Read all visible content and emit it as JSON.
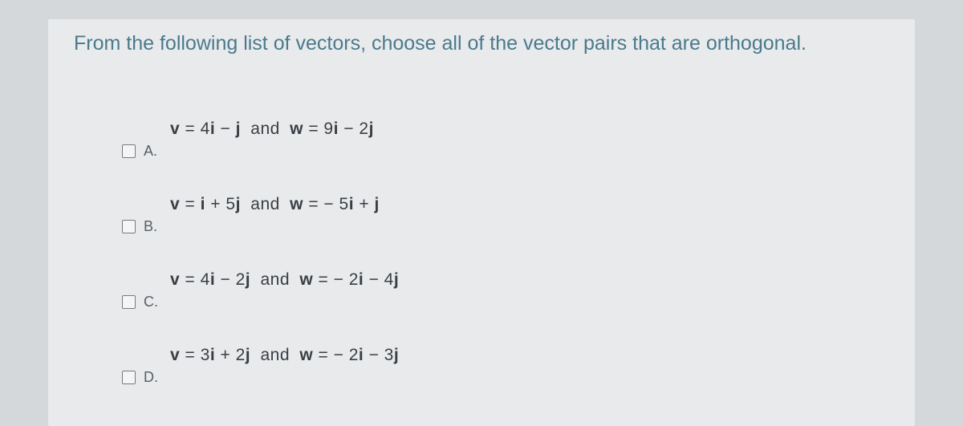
{
  "question": {
    "text": "From the following list of vectors, choose all of the vector pairs that are orthogonal."
  },
  "options": [
    {
      "letter": "A.",
      "v_prefix": "v",
      "v_equals": " = 4",
      "v_i": "i",
      "v_mid": " − ",
      "v_j": "j",
      "and": "  and  ",
      "w_prefix": "w",
      "w_equals": " = 9",
      "w_i": "i",
      "w_mid": " − 2",
      "w_j": "j"
    },
    {
      "letter": "B.",
      "v_prefix": "v",
      "v_equals": " = ",
      "v_i": "i",
      "v_mid": " + 5",
      "v_j": "j",
      "and": "  and  ",
      "w_prefix": "w",
      "w_equals": " = − 5",
      "w_i": "i",
      "w_mid": " + ",
      "w_j": "j"
    },
    {
      "letter": "C.",
      "v_prefix": "v",
      "v_equals": " = 4",
      "v_i": "i",
      "v_mid": " − 2",
      "v_j": "j",
      "and": "  and  ",
      "w_prefix": "w",
      "w_equals": " = − 2",
      "w_i": "i",
      "w_mid": " − 4",
      "w_j": "j"
    },
    {
      "letter": "D.",
      "v_prefix": "v",
      "v_equals": " = 3",
      "v_i": "i",
      "v_mid": " + 2",
      "v_j": "j",
      "and": "  and  ",
      "w_prefix": "w",
      "w_equals": " = − 2",
      "w_i": "i",
      "w_mid": " − 3",
      "w_j": "j"
    }
  ]
}
